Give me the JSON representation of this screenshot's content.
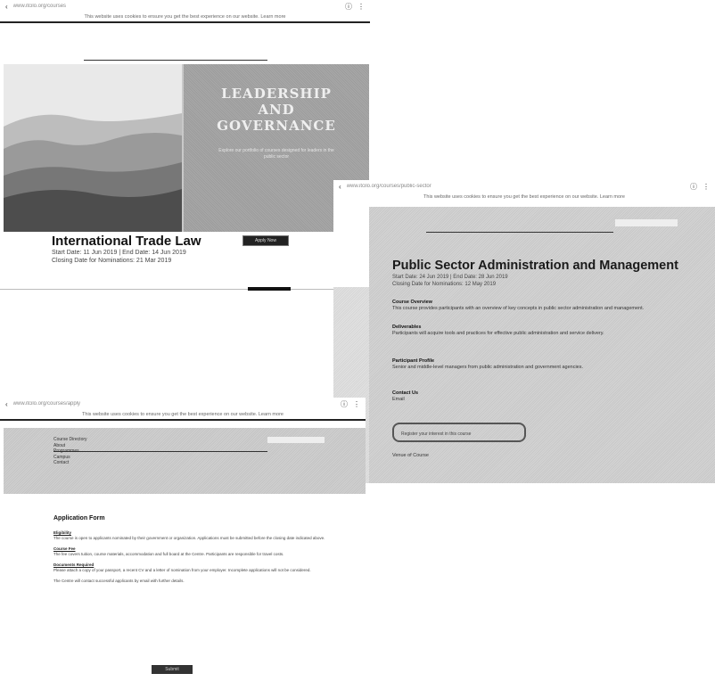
{
  "shot1": {
    "url": "www.itcilo.org/courses",
    "notice": "This website uses cookies to ensure you get the best experience on our website. Learn more",
    "hero_heading": [
      "LEADERSHIP",
      "AND",
      "GOVERNANCE"
    ],
    "hero_blurb": "Explore our portfolio of courses designed for leaders in the public sector",
    "course_title": "International Trade Law",
    "dates_line": "Start Date: 11 Jun 2019  |  End Date: 14 Jun 2019",
    "closing_line": "Closing Date for Nominations: 21 Mar 2019",
    "enroll_label": "Apply Now"
  },
  "shot2": {
    "url": "www.itcilo.org/courses/public-sector",
    "notice": "This website uses cookies to ensure you get the best experience on our website. Learn more",
    "course_title": "Public Sector Administration and Management",
    "dates_line": "Start Date: 24 Jun 2019  |  End Date: 28 Jun 2019",
    "closing_line": "Closing Date for Nominations: 12 May 2019",
    "sections": [
      {
        "label": "Course Overview",
        "text": "This course provides participants with an overview of key concepts in public sector administration and management."
      },
      {
        "label": "Deliverables",
        "text": "Participants will acquire tools and practices for effective public administration and service delivery."
      },
      {
        "label": "Participant Profile",
        "text": "Senior and middle-level managers from public administration and government agencies."
      },
      {
        "label": "Contact Us",
        "text": "Email"
      }
    ],
    "box_label": "Register your interest in this course",
    "footer_label": "Venue of Course"
  },
  "shot3": {
    "url": "www.itcilo.org/courses/apply",
    "notice": "This website uses cookies to ensure you get the best experience on our website. Learn more",
    "nav_items": [
      "Course Directory",
      "About",
      "Programmes",
      "Campus",
      "Contact"
    ]
  },
  "shot4": {
    "heading": "Application Form",
    "blocks": [
      {
        "label": "Eligibility",
        "text": "The course is open to applicants nominated by their government or organization. Applications must be submitted before the closing date indicated above."
      },
      {
        "label": "Course Fee",
        "text": "The fee covers tuition, course materials, accommodation and full board at the Centre. Participants are responsible for travel costs."
      },
      {
        "label": "Documents Required",
        "text": "Please attach a copy of your passport, a recent CV and a letter of nomination from your employer. Incomplete applications will not be considered."
      }
    ],
    "note": "The Centre will contact successful applicants by email with further details.",
    "submit_label": "Submit"
  }
}
